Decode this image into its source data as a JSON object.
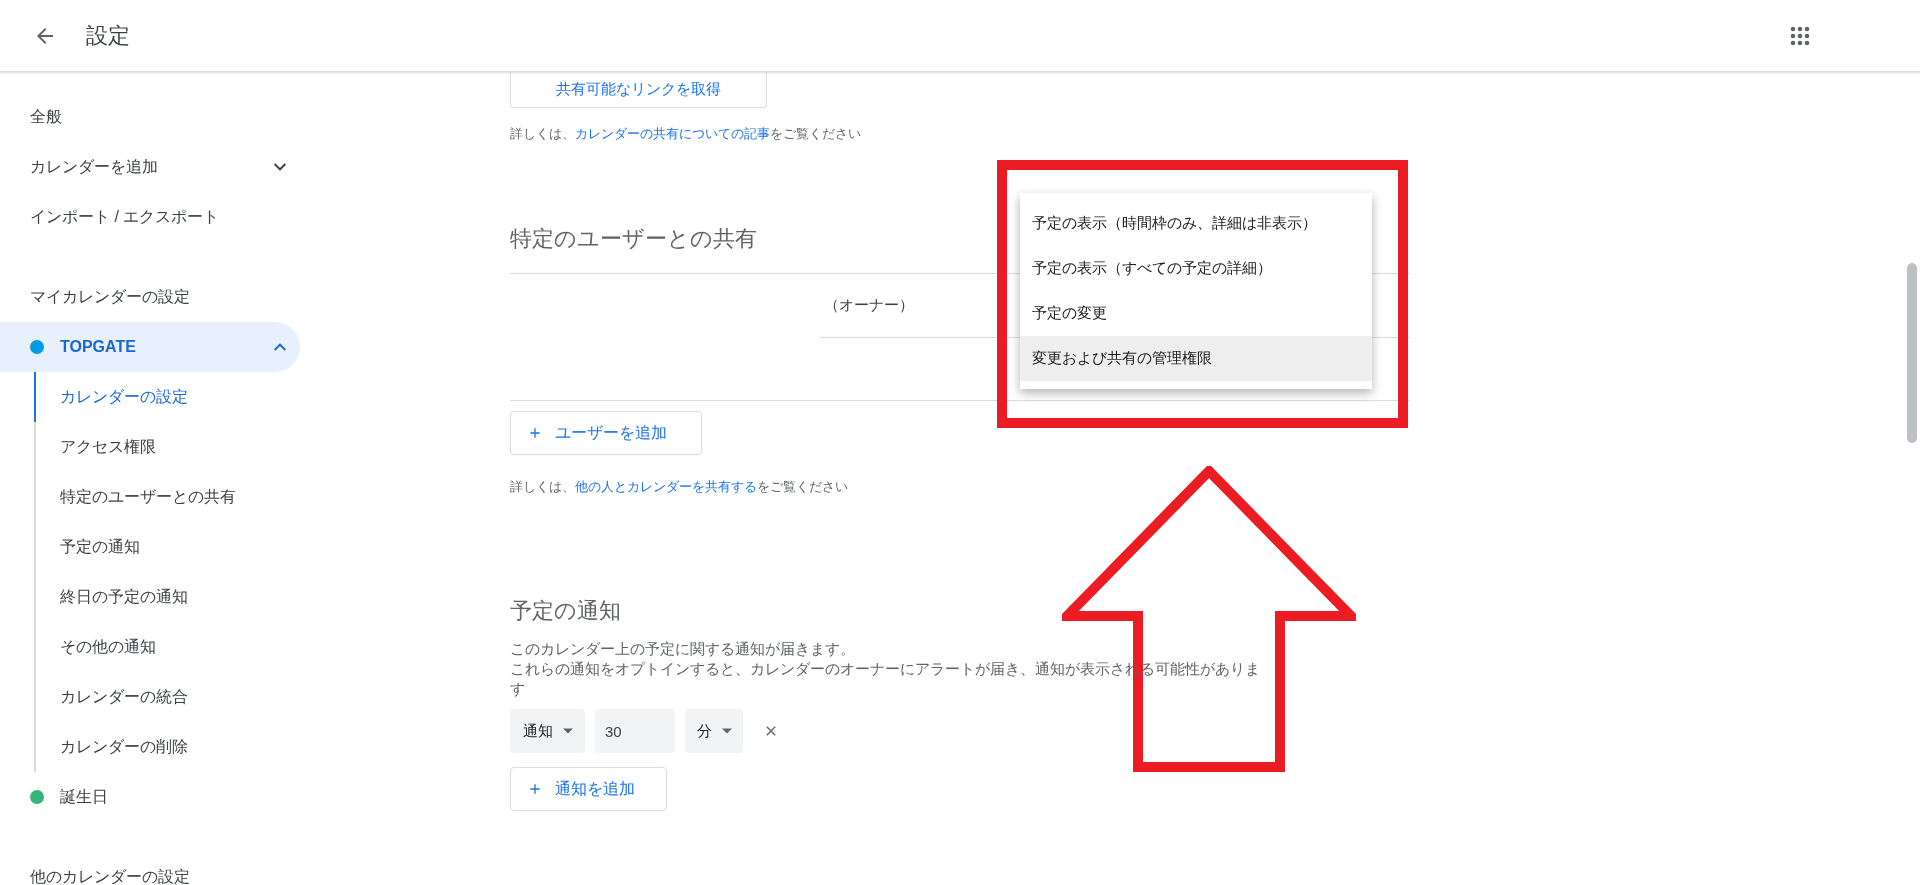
{
  "header": {
    "title": "設定"
  },
  "sidebar": {
    "items": [
      {
        "kind": "link",
        "label": "全般"
      },
      {
        "kind": "expander",
        "label": "カレンダーを追加",
        "expanded": false
      },
      {
        "kind": "link",
        "label": "インポート / エクスポート"
      },
      {
        "kind": "heading",
        "label": "マイカレンダーの設定"
      },
      {
        "kind": "calendar",
        "label": "TOPGATE",
        "color": "#039be5",
        "expanded": true,
        "selected": true,
        "children": [
          {
            "label": "カレンダーの設定",
            "selected": true
          },
          {
            "label": "アクセス権限",
            "selected": false
          },
          {
            "label": "特定のユーザーとの共有",
            "selected": false
          },
          {
            "label": "予定の通知",
            "selected": false
          },
          {
            "label": "終日の予定の通知",
            "selected": false
          },
          {
            "label": "その他の通知",
            "selected": false
          },
          {
            "label": "カレンダーの統合",
            "selected": false
          },
          {
            "label": "カレンダーの削除",
            "selected": false
          }
        ]
      },
      {
        "kind": "calendar",
        "label": "誕生日",
        "color": "#33b679",
        "selected": false
      },
      {
        "kind": "heading",
        "label": "他のカレンダーの設定"
      }
    ]
  },
  "access": {
    "link_button": "共有可能なリンクを取得",
    "help": {
      "prefix": "詳しくは、",
      "link": "カレンダーの共有についての記事",
      "suffix": "をご覧ください"
    }
  },
  "sharing": {
    "title": "特定のユーザーとの共有",
    "owner": "（オーナー）",
    "add_button": "ユーザーを追加",
    "help": {
      "prefix": "詳しくは、",
      "link": "他の人とカレンダーを共有する",
      "suffix": "をご覧ください"
    }
  },
  "permission_menu": {
    "items": [
      {
        "label": "予定の表示（時間枠のみ、詳細は非表示）",
        "selected": false
      },
      {
        "label": "予定の表示（すべての予定の詳細）",
        "selected": false
      },
      {
        "label": "予定の変更",
        "selected": false
      },
      {
        "label": "変更および共有の管理権限",
        "selected": true
      }
    ]
  },
  "notifications": {
    "title": "予定の通知",
    "description": [
      "このカレンダー上の予定に関する通知が届きます。",
      "これらの通知をオプトインすると、カレンダーのオーナーにアラートが届き、通知が表示される可能性があります"
    ],
    "rows": [
      {
        "type": "通知",
        "amount": "30",
        "unit": "分"
      }
    ],
    "add_button": "通知を追加"
  }
}
